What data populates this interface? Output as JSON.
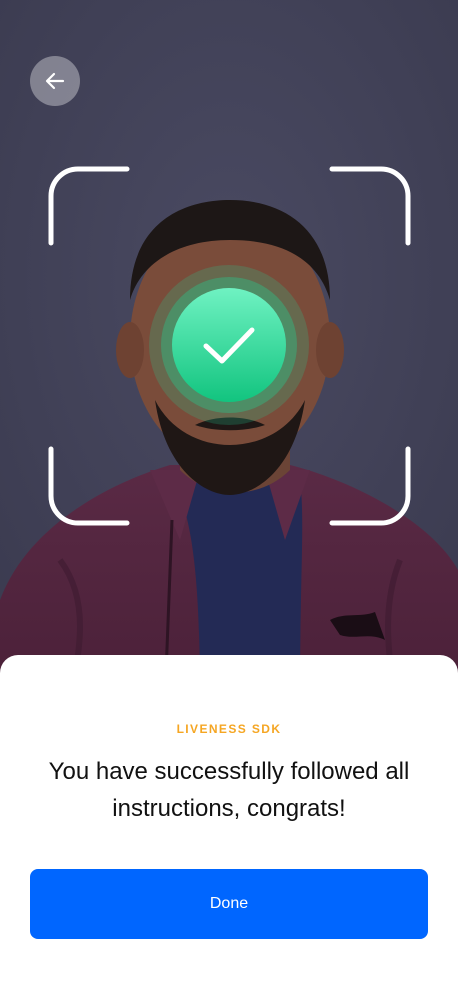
{
  "camera": {
    "back_icon": "arrow-left-icon",
    "status_icon": "checkmark-icon",
    "colors": {
      "backdrop": "#3f3f55",
      "check_green": "#12c98a",
      "frame": "#ffffff"
    }
  },
  "sheet": {
    "eyebrow": "LIVENESS SDK",
    "message": "You have successfully followed all instructions, congrats!",
    "done_label": "Done",
    "colors": {
      "eyebrow": "#f5a623",
      "button": "#0066ff"
    }
  }
}
